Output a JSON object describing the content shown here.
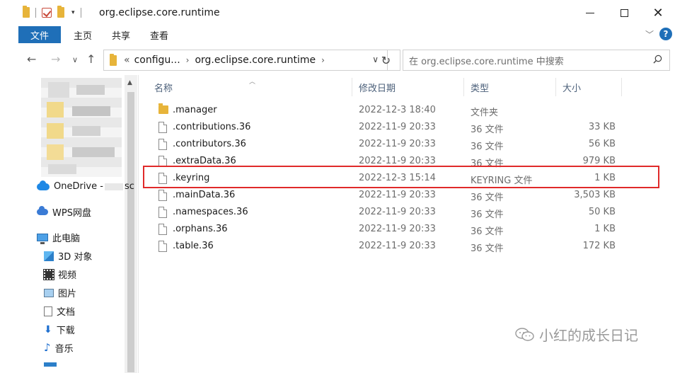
{
  "window": {
    "title": "org.eclipse.core.runtime",
    "minimize": "—",
    "maximize": "☐",
    "close": "✕"
  },
  "ribbon": {
    "tabs": [
      "文件",
      "主页",
      "共享",
      "查看"
    ],
    "help": "?"
  },
  "address": {
    "overflow": "«",
    "crumbs": [
      "configu...",
      "org.eclipse.core.runtime"
    ],
    "search_placeholder": "在 org.eclipse.core.runtime 中搜索"
  },
  "nav": {
    "onedrive": "OneDrive - ",
    "onedrive_suffix": "sc",
    "wps": "WPS网盘",
    "thispc": "此电脑",
    "items": [
      "3D 对象",
      "视频",
      "图片",
      "文档",
      "下载",
      "音乐"
    ]
  },
  "columns": {
    "name": "名称",
    "date": "修改日期",
    "type": "类型",
    "size": "大小"
  },
  "files": [
    {
      "name": ".manager",
      "date": "2022-12-3 18:40",
      "type": "文件夹",
      "size": "",
      "folder": true
    },
    {
      "name": ".contributions.36",
      "date": "2022-11-9 20:33",
      "type": "36 文件",
      "size": "33 KB"
    },
    {
      "name": ".contributors.36",
      "date": "2022-11-9 20:33",
      "type": "36 文件",
      "size": "56 KB"
    },
    {
      "name": ".extraData.36",
      "date": "2022-11-9 20:33",
      "type": "36 文件",
      "size": "979 KB"
    },
    {
      "name": ".keyring",
      "date": "2022-12-3 15:14",
      "type": "KEYRING 文件",
      "size": "1 KB",
      "highlighted": true
    },
    {
      "name": ".mainData.36",
      "date": "2022-11-9 20:33",
      "type": "36 文件",
      "size": "3,503 KB"
    },
    {
      "name": ".namespaces.36",
      "date": "2022-11-9 20:33",
      "type": "36 文件",
      "size": "50 KB"
    },
    {
      "name": ".orphans.36",
      "date": "2022-11-9 20:33",
      "type": "36 文件",
      "size": "1 KB"
    },
    {
      "name": ".table.36",
      "date": "2022-11-9 20:33",
      "type": "36 文件",
      "size": "172 KB"
    }
  ],
  "watermark": "小红的成长日记",
  "colors": {
    "accent": "#1f6fb8",
    "highlight_border": "#e02a2a",
    "folder": "#e7b43a"
  }
}
